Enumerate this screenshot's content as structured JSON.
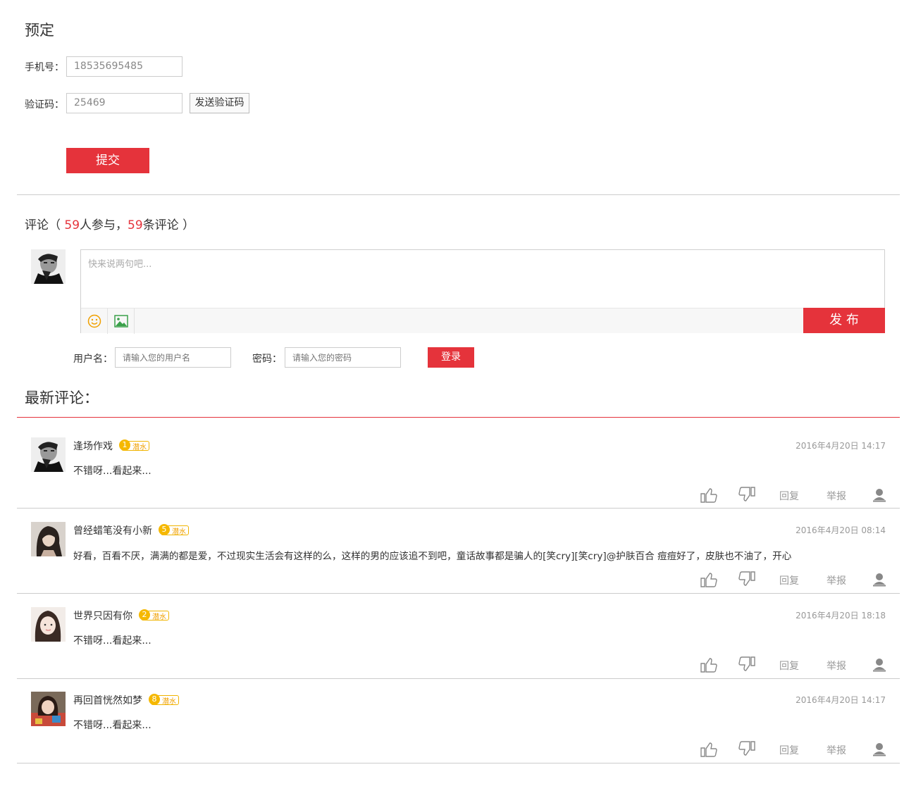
{
  "booking": {
    "title": "预定",
    "phone_label": "手机号：",
    "phone_value": "18535695485",
    "code_label": "验证码：",
    "code_value": "25469",
    "send_code_label": "发送验证码",
    "submit_label": "提交"
  },
  "comments_header": {
    "prefix": "评论（ ",
    "participants": "59",
    "middle": "人参与，",
    "count": "59",
    "suffix": "条评论 ）"
  },
  "composer": {
    "placeholder": "快来说两句吧...",
    "publish_label": "发 布",
    "username_label": "用户名：",
    "username_placeholder": "请输入您的用户名",
    "password_label": "密码：",
    "password_placeholder": "请输入您的密码",
    "login_label": "登录"
  },
  "latest": {
    "title": "最新评论：",
    "reply_label": "回复",
    "report_label": "举报",
    "items": [
      {
        "name": "逢场作戏",
        "level": "1",
        "badge": "潜水",
        "time": "2016年4月20日 14:17",
        "text": "不错呀...看起来..."
      },
      {
        "name": "曾经蜡笔没有小新",
        "level": "5",
        "badge": "潜水",
        "time": "2016年4月20日 08:14",
        "text": "好看，百看不厌，满满的都是爱，不过现实生活会有这样的么，这样的男的应该追不到吧，童话故事都是骗人的[笑cry][笑cry]@护肤百合   痘痘好了，皮肤也不油了，开心"
      },
      {
        "name": "世界只因有你",
        "level": "2",
        "badge": "潜水",
        "time": "2016年4月20日 18:18",
        "text": "不错呀...看起来..."
      },
      {
        "name": "再回首恍然如梦",
        "level": "8",
        "badge": "潜水",
        "time": "2016年4月20日 14:17",
        "text": "不错呀...看起来..."
      }
    ]
  },
  "colors": {
    "accent": "#e5333b",
    "badge": "#f5b800",
    "divider": "#cccccc"
  }
}
